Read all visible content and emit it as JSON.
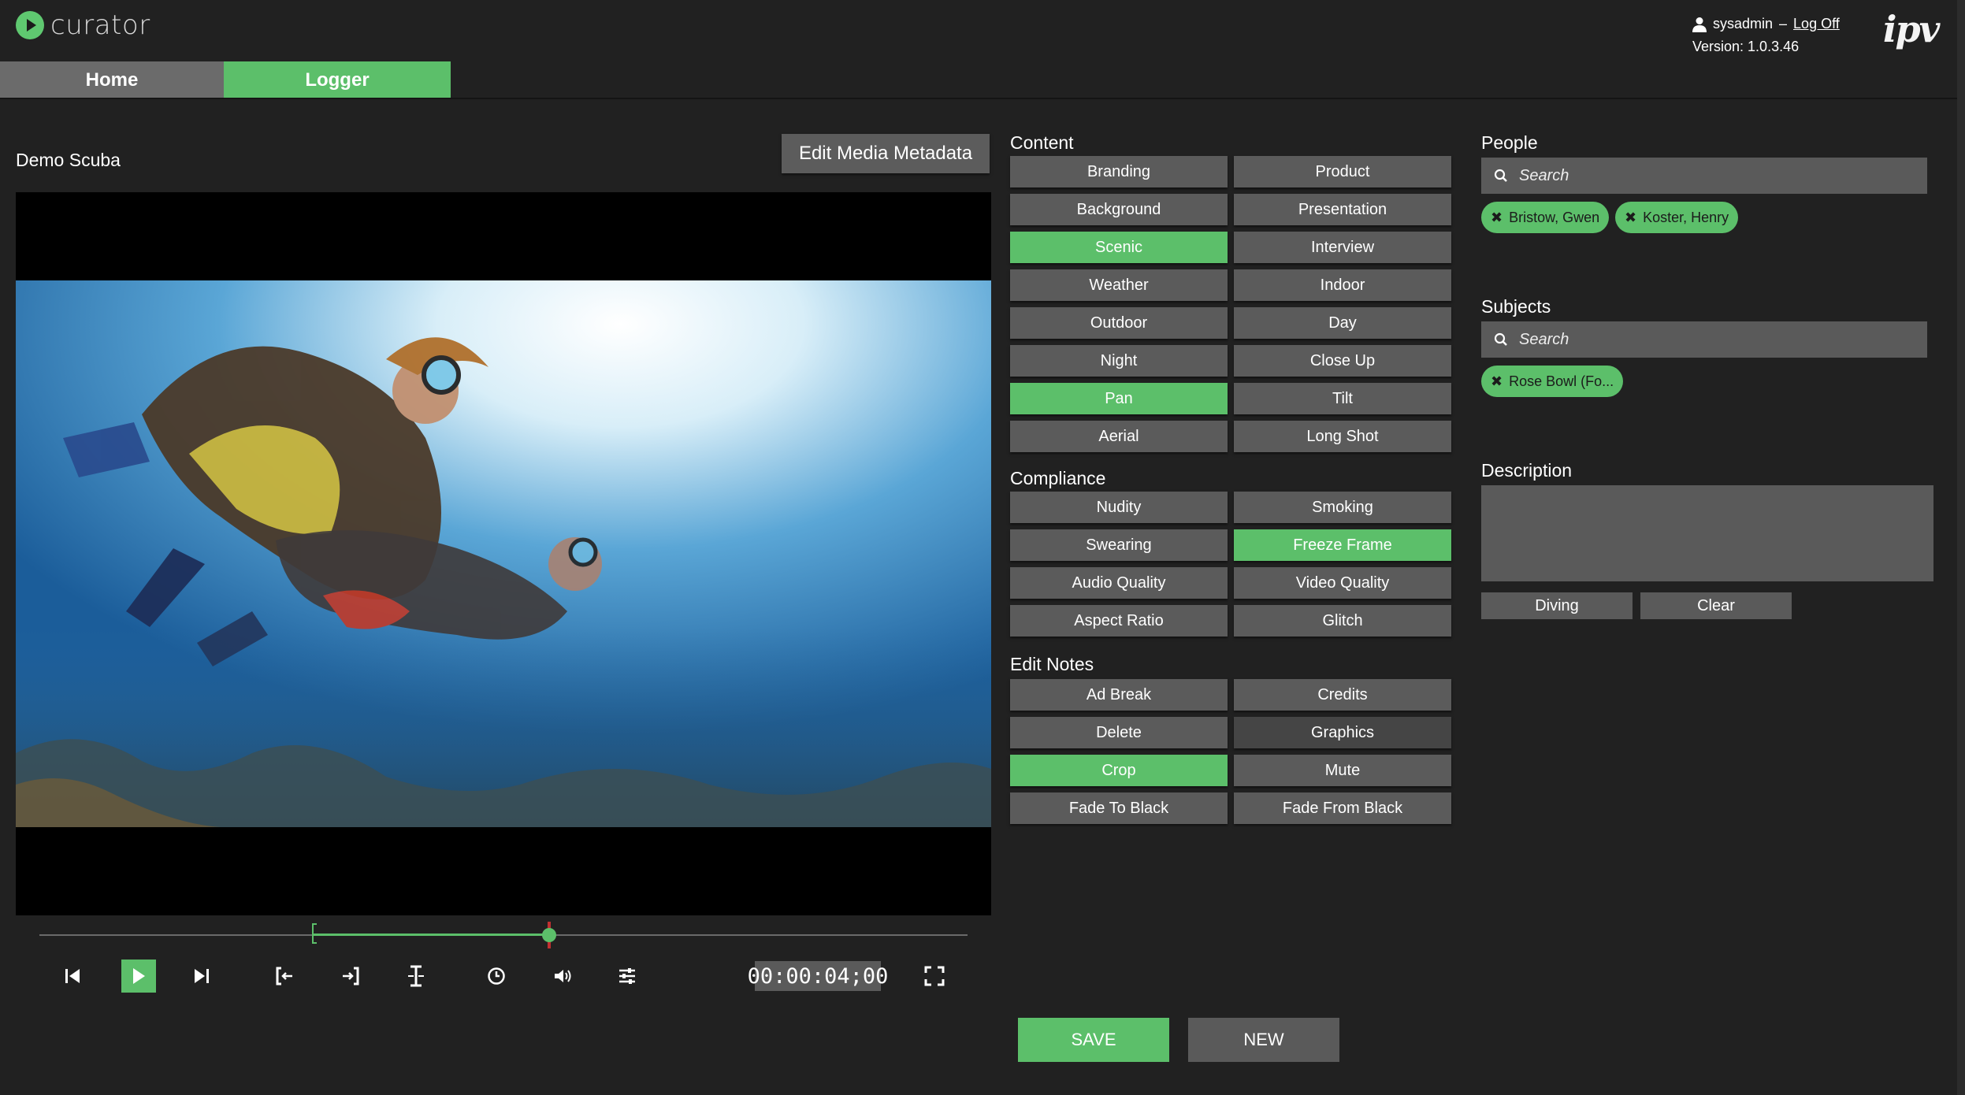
{
  "header": {
    "logo_text": "curator",
    "brand": "ipv",
    "username": "sysadmin",
    "separator": "–",
    "logoff": "Log Off",
    "version": "Version: 1.0.3.46"
  },
  "nav": {
    "home": "Home",
    "logger": "Logger",
    "active": "Logger"
  },
  "player": {
    "media_title": "Demo Scuba",
    "edit_metadata": "Edit Media Metadata",
    "timecode": "00:00:04;00",
    "in_fraction": 0.296,
    "playhead_fraction": 0.55
  },
  "content": {
    "heading": "Content",
    "tags": [
      {
        "label": "Branding",
        "on": false
      },
      {
        "label": "Product",
        "on": false
      },
      {
        "label": "Background",
        "on": false
      },
      {
        "label": "Presentation",
        "on": false
      },
      {
        "label": "Scenic",
        "on": true
      },
      {
        "label": "Interview",
        "on": false
      },
      {
        "label": "Weather",
        "on": false
      },
      {
        "label": "Indoor",
        "on": false
      },
      {
        "label": "Outdoor",
        "on": false
      },
      {
        "label": "Day",
        "on": false
      },
      {
        "label": "Night",
        "on": false
      },
      {
        "label": "Close Up",
        "on": false
      },
      {
        "label": "Pan",
        "on": true
      },
      {
        "label": "Tilt",
        "on": false
      },
      {
        "label": "Aerial",
        "on": false
      },
      {
        "label": "Long Shot",
        "on": false
      }
    ]
  },
  "compliance": {
    "heading": "Compliance",
    "tags": [
      {
        "label": "Nudity",
        "on": false
      },
      {
        "label": "Smoking",
        "on": false
      },
      {
        "label": "Swearing",
        "on": false
      },
      {
        "label": "Freeze Frame",
        "on": true
      },
      {
        "label": "Audio Quality",
        "on": false
      },
      {
        "label": "Video Quality",
        "on": false
      },
      {
        "label": "Aspect Ratio",
        "on": false
      },
      {
        "label": "Glitch",
        "on": false
      }
    ]
  },
  "edit_notes": {
    "heading": "Edit Notes",
    "tags": [
      {
        "label": "Ad Break",
        "on": false
      },
      {
        "label": "Credits",
        "on": false
      },
      {
        "label": "Delete",
        "on": false
      },
      {
        "label": "Graphics",
        "on": false,
        "dim": true
      },
      {
        "label": "Crop",
        "on": true
      },
      {
        "label": "Mute",
        "on": false
      },
      {
        "label": "Fade To Black",
        "on": false
      },
      {
        "label": "Fade From Black",
        "on": false
      }
    ]
  },
  "people": {
    "heading": "People",
    "search_placeholder": "Search",
    "chips": [
      "Bristow, Gwen",
      "Koster, Henry"
    ]
  },
  "subjects": {
    "heading": "Subjects",
    "search_placeholder": "Search",
    "chips": [
      "Rose Bowl (Fo..."
    ]
  },
  "description": {
    "heading": "Description",
    "value": "",
    "diving": "Diving",
    "clear": "Clear"
  },
  "actions": {
    "save": "SAVE",
    "new": "NEW"
  },
  "colors": {
    "accent": "#5cbf6a",
    "panel": "#5b5b5b",
    "background": "#212121"
  }
}
